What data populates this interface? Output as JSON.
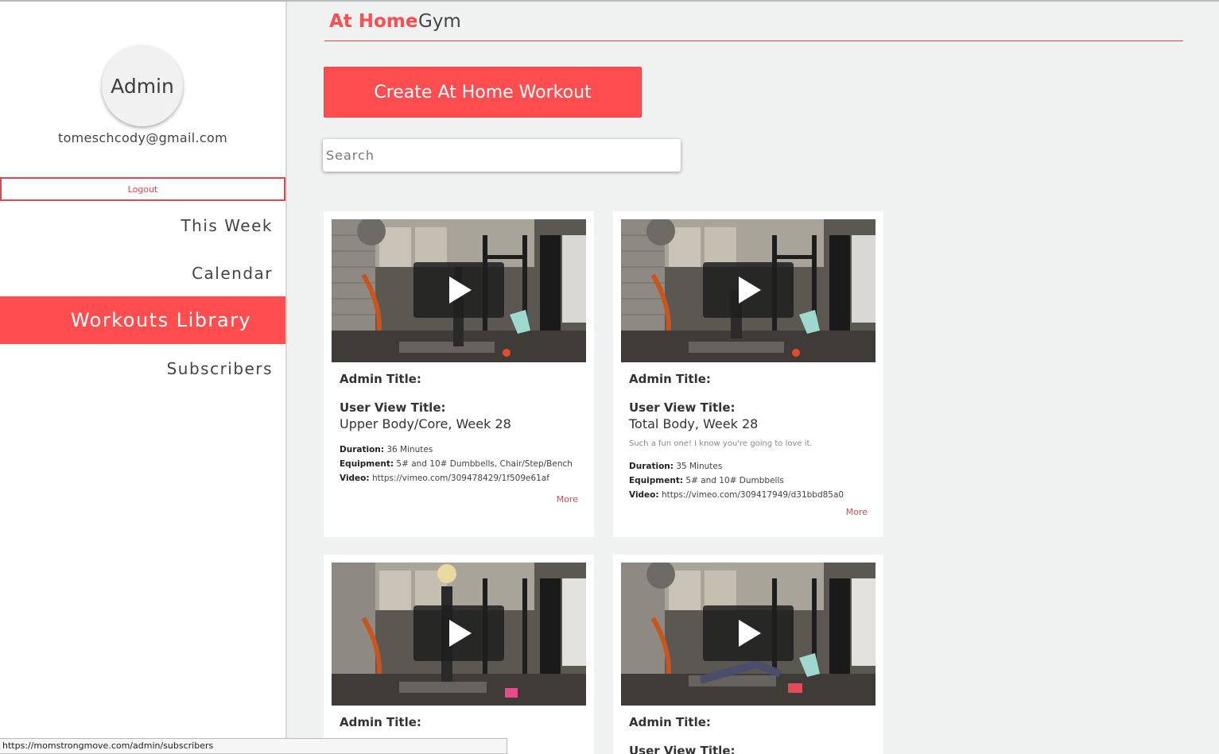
{
  "sidebar": {
    "avatar_text": "Admin",
    "email": "tomeschcody@gmail.com",
    "logout_label": "Logout",
    "nav": [
      {
        "label": "This Week"
      },
      {
        "label": "Calendar"
      },
      {
        "label": "Workouts Library",
        "active": true
      },
      {
        "label": "Subscribers"
      }
    ]
  },
  "tabs": {
    "at_home": "At Home",
    "gym": "Gym"
  },
  "create_button_label": "Create At Home Workout",
  "search": {
    "placeholder": "Search",
    "value": ""
  },
  "colors": {
    "accent": "#ff4d50",
    "background": "#f0f1f1"
  },
  "cards": [
    {
      "admin_title_label": "Admin Title:",
      "user_view_title_label": "User View Title:",
      "user_view_title": "Upper Body/Core, Week 28",
      "description": "",
      "duration_label": "Duration:",
      "duration": "36 Minutes",
      "equipment_label": "Equipment:",
      "equipment": "5# and 10# Dumbbells, Chair/Step/Bench",
      "video_label": "Video:",
      "video": "https://vimeo.com/309478429/1f509e61af",
      "more_label": "More"
    },
    {
      "admin_title_label": "Admin Title:",
      "user_view_title_label": "User View Title:",
      "user_view_title": "Total Body, Week 28",
      "description": "Such a fun one! I know you're going to love it.",
      "duration_label": "Duration:",
      "duration": "35 Minutes",
      "equipment_label": "Equipment:",
      "equipment": "5# and 10# Dumbbells",
      "video_label": "Video:",
      "video": "https://vimeo.com/309417949/d31bbd85a0",
      "more_label": "More"
    },
    {
      "admin_title_label": "Admin Title:"
    },
    {
      "admin_title_label": "Admin Title:",
      "user_view_title_label": "User View Title:"
    }
  ],
  "statusbar_url": "https://momstrongmove.com/admin/subscribers"
}
